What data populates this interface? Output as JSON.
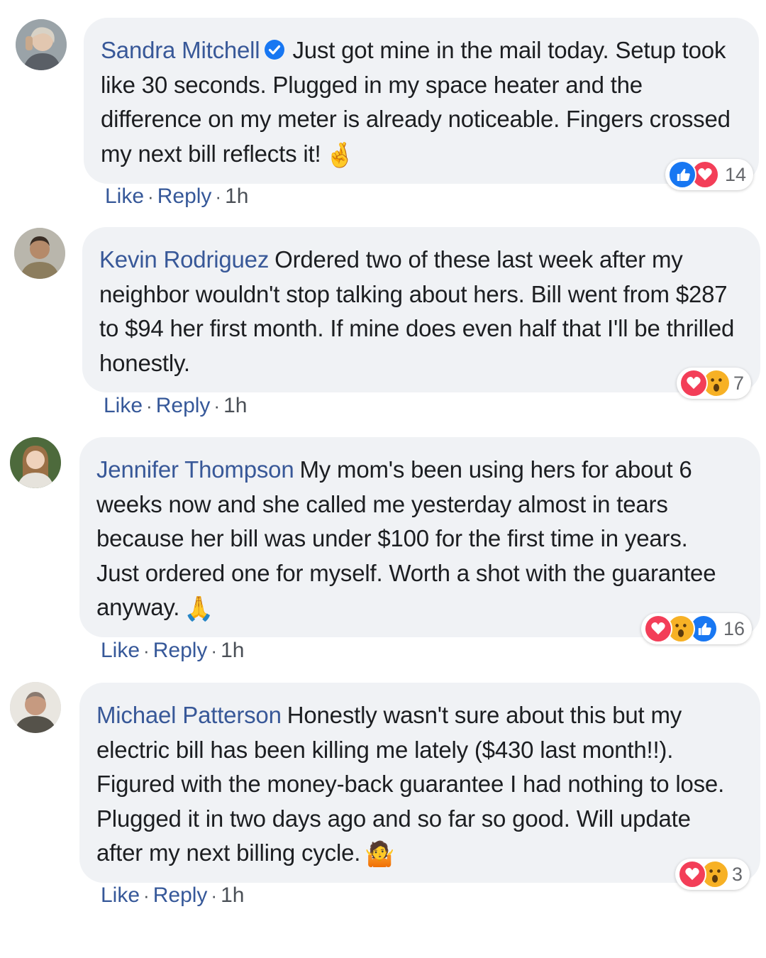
{
  "comments": [
    {
      "author": "Sandra Mitchell",
      "verified": true,
      "text": "Just got mine in the mail today. Setup took like 30 seconds. Plugged in my space heater and the difference on my meter is already noticeable. Fingers crossed my next bill reflects it!",
      "emoji": "🤞",
      "reactions": [
        "like",
        "love"
      ],
      "reaction_count": "14",
      "actions": {
        "like": "Like",
        "reply": "Reply",
        "time": "1h"
      }
    },
    {
      "author": "Kevin Rodriguez",
      "verified": false,
      "text": "Ordered two of these last week after my neighbor wouldn't stop talking about hers. Bill went from $287 to $94 her first month. If mine does even half that I'll be thrilled honestly.",
      "emoji": "",
      "reactions": [
        "love",
        "wow"
      ],
      "reaction_count": "7",
      "actions": {
        "like": "Like",
        "reply": "Reply",
        "time": "1h"
      }
    },
    {
      "author": "Jennifer Thompson",
      "verified": false,
      "text": "My mom's been using hers for about 6 weeks now and she called me yesterday almost in tears because her bill was under $100 for the first time in years. Just ordered one for myself. Worth a shot with the guarantee anyway.",
      "emoji": "🙏",
      "reactions": [
        "love",
        "wow",
        "like"
      ],
      "reaction_count": "16",
      "actions": {
        "like": "Like",
        "reply": "Reply",
        "time": "1h"
      }
    },
    {
      "author": "Michael Patterson",
      "verified": false,
      "text": "Honestly wasn't sure about this but my electric bill has been killing me lately ($430 last month!!). Figured with the money-back guarantee I had nothing to lose. Plugged it in two days ago and so far so good. Will update after my next billing cycle.",
      "emoji": "🤷",
      "reactions": [
        "love",
        "wow"
      ],
      "reaction_count": "3",
      "actions": {
        "like": "Like",
        "reply": "Reply",
        "time": "1h"
      }
    }
  ],
  "colors": {
    "author": "#385898",
    "link": "#365899",
    "bubble": "#f0f2f5",
    "like": "#1877f2",
    "love": "#f33e58",
    "wow": "#f7b125"
  },
  "icons": {
    "verified": "verified-badge-icon",
    "like": "like-reaction-icon",
    "love": "love-reaction-icon",
    "wow": "wow-reaction-icon"
  }
}
